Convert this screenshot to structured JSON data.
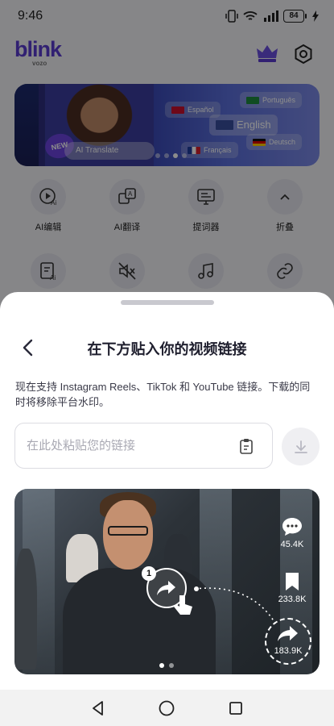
{
  "status_bar": {
    "time": "9:46",
    "battery": "84"
  },
  "app": {
    "brand": "blink",
    "brand_sub": "vozo",
    "banner": {
      "badge": "NEW",
      "caption": "AI Translate",
      "languages": [
        "Español",
        "Português",
        "English",
        "Français",
        "Deutsch"
      ]
    },
    "tools_row1": [
      {
        "label": "AI编辑",
        "icon": "ai-edit-icon"
      },
      {
        "label": "AI翻译",
        "icon": "ai-translate-icon"
      },
      {
        "label": "提词器",
        "icon": "teleprompter-icon"
      },
      {
        "label": "折叠",
        "icon": "chevron-up-icon"
      }
    ],
    "tools_row2": [
      {
        "icon": "ai-subtitle-icon"
      },
      {
        "icon": "mute-icon"
      },
      {
        "icon": "music-icon"
      },
      {
        "icon": "link-icon"
      }
    ]
  },
  "sheet": {
    "title": "在下方贴入你的视频链接",
    "description": "现在支持 Instagram Reels、TikTok 和 YouTube 链接。下载的同时将移除平台水印。",
    "input_placeholder": "在此处粘贴您的链接",
    "preview": {
      "step": "1",
      "comments": "45.4K",
      "saves": "233.8K",
      "shares": "183.9K"
    }
  },
  "colors": {
    "brand": "#5a3bd0",
    "overlay": "rgba(0,0,0,0.45)"
  }
}
